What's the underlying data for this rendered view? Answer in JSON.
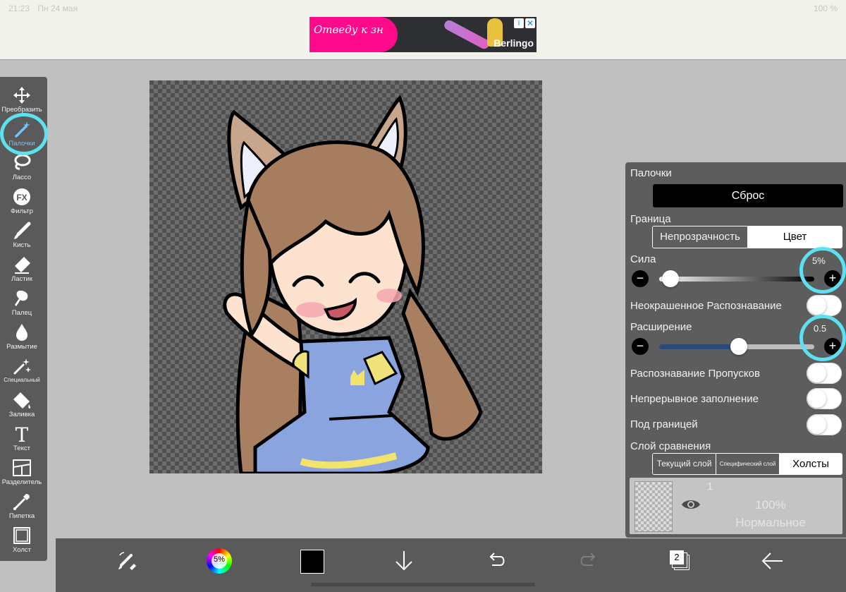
{
  "status_bar": {
    "time": "21:23",
    "date": "Пн 24 мая",
    "battery": "100 %"
  },
  "ad": {
    "text": "Отведу к зн",
    "brand": "Berlingo",
    "info_icon": "info-icon",
    "close_icon": "close-icon"
  },
  "toolbar": {
    "items": [
      {
        "label": "Преобразить",
        "icon": "move-icon"
      },
      {
        "label": "Палочки",
        "icon": "magic-wand-icon",
        "active": true
      },
      {
        "label": "Лассо",
        "icon": "lasso-icon"
      },
      {
        "label": "Фильтр",
        "icon": "fx-icon"
      },
      {
        "label": "Кисть",
        "icon": "brush-icon"
      },
      {
        "label": "Ластик",
        "icon": "eraser-icon"
      },
      {
        "label": "Палец",
        "icon": "smudge-icon"
      },
      {
        "label": "Размытие",
        "icon": "blur-drop-icon"
      },
      {
        "label": "Специальный",
        "icon": "sparkle-icon"
      },
      {
        "label": "Заливка",
        "icon": "fill-bucket-icon"
      },
      {
        "label": "Текст",
        "icon": "text-icon"
      },
      {
        "label": "Разделитель",
        "icon": "divider-icon"
      },
      {
        "label": "Пипетка",
        "icon": "eyedropper-icon"
      },
      {
        "label": "Холст",
        "icon": "canvas-icon"
      }
    ]
  },
  "panel": {
    "title": "Палочки",
    "reset_label": "Сброс",
    "border_label": "Граница",
    "border_options": [
      "Непрозрачность",
      "Цвет"
    ],
    "border_selected": "Цвет",
    "strength_label": "Сила",
    "strength_value": "5%",
    "strength_fraction": 0.05,
    "uncolored_label": "Неокрашенное Распознавание",
    "expand_label": "Расширение",
    "expand_value": "0.5",
    "expand_fraction": 0.53,
    "gap_label": "Распознавание Пропусков",
    "continuous_label": "Непрерывное заполнение",
    "under_border_label": "Под границей",
    "compare_label": "Слой сравнения",
    "compare_options": [
      "Текущий слой",
      "Специфический слой",
      "Холсты"
    ],
    "compare_selected": "Холсты",
    "layer": {
      "number": "1",
      "opacity": "100%",
      "mode": "Нормальное"
    }
  },
  "bottom_bar": {
    "color_wheel_value": "5%",
    "current_color": "#000000",
    "layers_count": "2"
  },
  "colors": {
    "highlight": "#5de0ef",
    "active_tool": "#6fc6ff",
    "slider_blue": "#2c4a7a"
  }
}
